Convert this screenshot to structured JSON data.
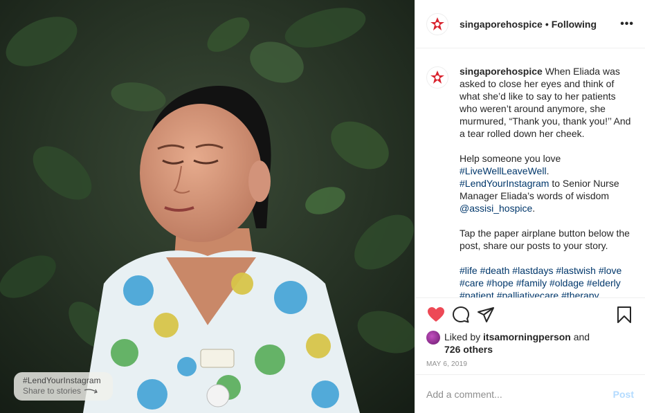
{
  "header": {
    "username": "singaporehospice",
    "separator": "•",
    "following_label": "Following",
    "more_label": "•••"
  },
  "caption": {
    "username": "singaporehospice",
    "paragraph1": "When Eliada was asked to close her eyes and think of what she’d like to say to her patients who weren’t around anymore, she murmured, “Thank you, thank you!’’ And a tear rolled down her cheek.",
    "p2_text1": "Help someone you love ",
    "p2_tag1": "#LiveWellLeaveWell",
    "p2_text2": ". ",
    "p2_tag2": "#LendYourInstagram",
    "p2_text3": " to Senior Nurse Manager Eliada’s words of wisdom ",
    "p2_mention": "@assisi_hospice",
    "p2_text4": ".",
    "paragraph3": "Tap the paper airplane button below the post, share our posts to your story.",
    "hashtags": [
      "#life",
      "#death",
      "#lastdays",
      "#lastwish",
      "#love",
      "#care",
      "#hope",
      "#family",
      "#oldage",
      "#elderly",
      "#patient",
      "#palliativecare",
      "#therapy"
    ]
  },
  "actions": {
    "like_icon": "heart-filled-icon",
    "comment_icon": "comment-icon",
    "share_icon": "paper-plane-icon",
    "save_icon": "bookmark-icon",
    "like_color": "#ed4956"
  },
  "likes": {
    "prefix": "Liked by ",
    "user": "itsamorningperson",
    "connector": " and",
    "others": "726 others"
  },
  "date": "MAY 6, 2019",
  "comment": {
    "placeholder": "Add a comment...",
    "post_label": "Post"
  },
  "photo_overlay": {
    "hashtag": "#LendYourInstagram",
    "sub": "Share to stories"
  },
  "colors": {
    "brand_red": "#d9232e",
    "link_blue": "#00376b",
    "post_disabled": "#b3dbff"
  }
}
